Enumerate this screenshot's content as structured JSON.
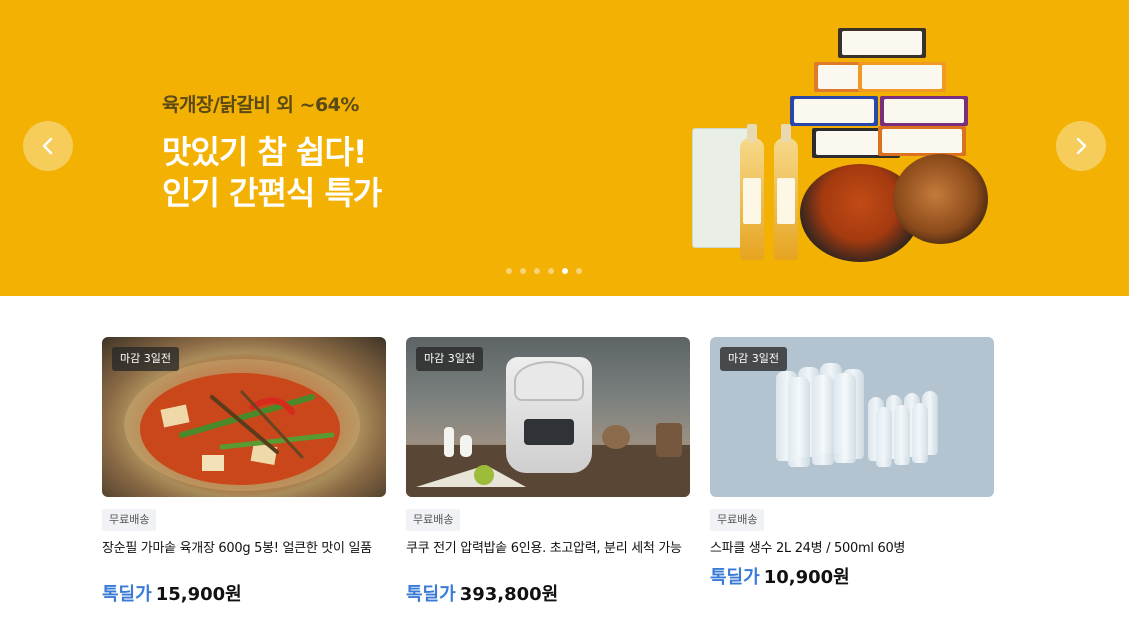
{
  "banner": {
    "subtitle": "육개장/닭갈비 외 ~64%",
    "title_line1": "맛있기 참 쉽다!",
    "title_line2": "인기 간편식 특가",
    "background": "#f2b103",
    "prev_icon": "chevron-left-icon",
    "next_icon": "chevron-right-icon",
    "slide_count": 6,
    "active_slide": 5
  },
  "products": [
    {
      "badge": "마감 3일전",
      "shipping": "무료배송",
      "name": "장순필 가마솥 육개장 600g 5봉! 얼큰한 맛이 일품",
      "price_tag": "톡딜가",
      "price": "15,900원"
    },
    {
      "badge": "마감 3일전",
      "shipping": "무료배송",
      "name": "쿠쿠 전기 압력밥솥 6인용. 초고압력, 분리 세척 가능",
      "price_tag": "톡딜가",
      "price": "393,800원"
    },
    {
      "badge": "마감 3일전",
      "shipping": "무료배송",
      "name": "스파클 생수 2L 24병 / 500ml 60병",
      "price_tag": "톡딜가",
      "price": "10,900원"
    }
  ],
  "colors": {
    "price_tag": "#3b7bd8"
  }
}
